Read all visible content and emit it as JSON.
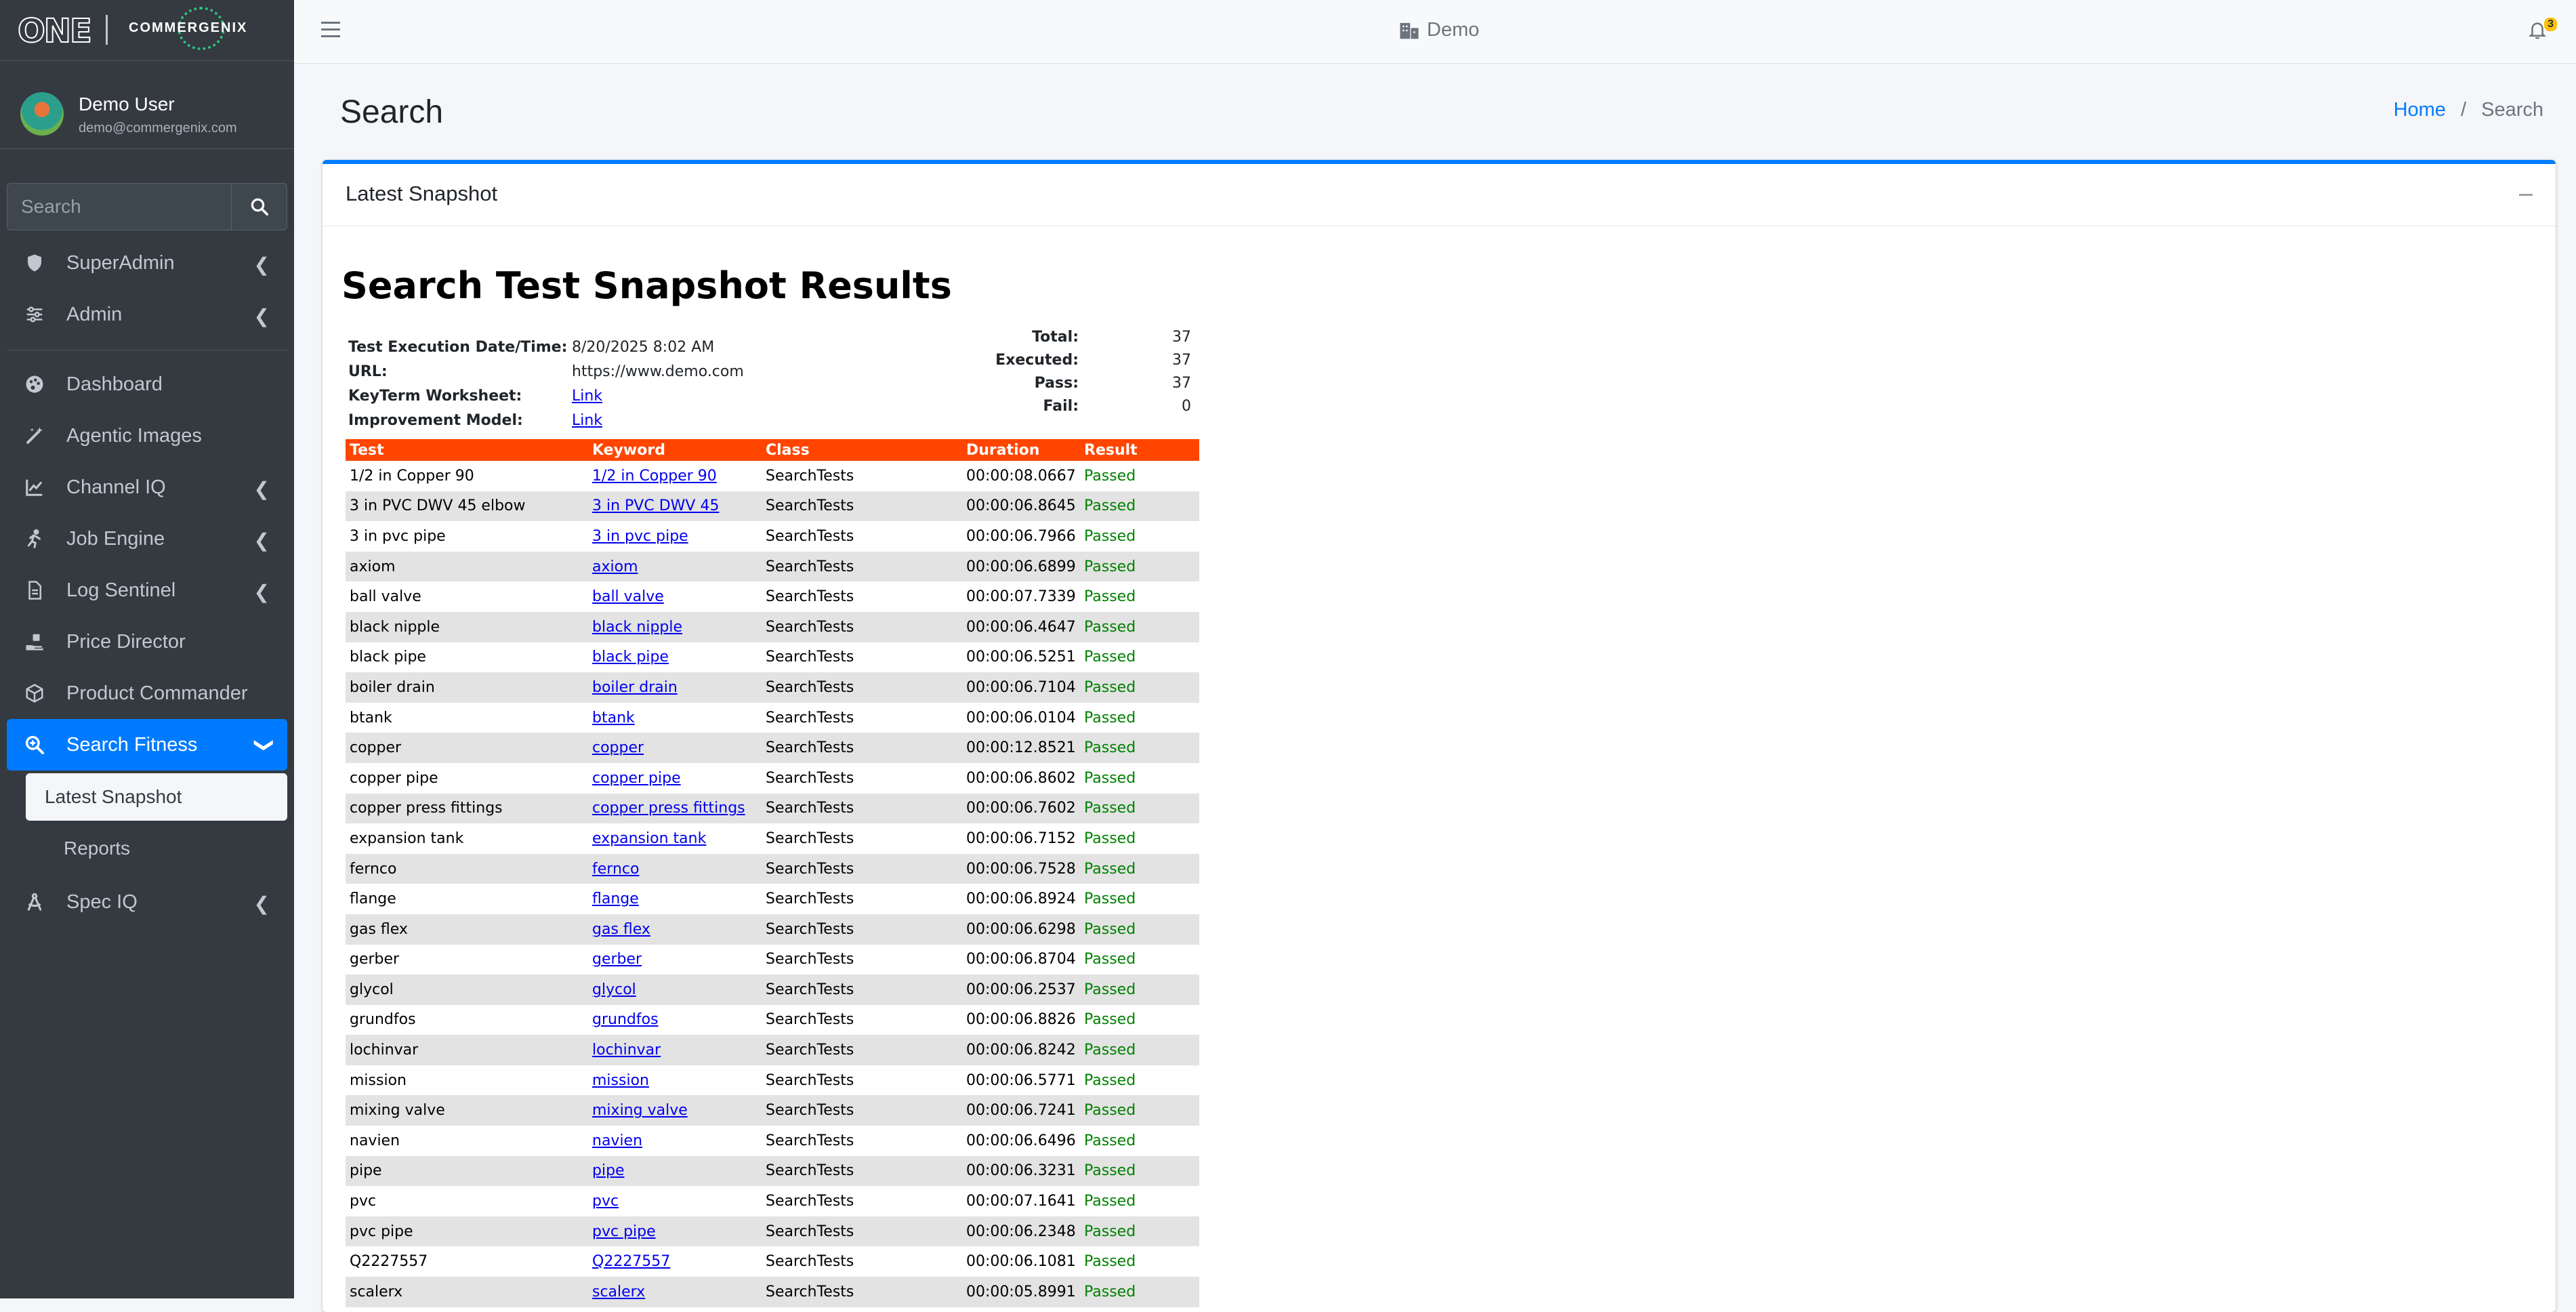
{
  "brand": {
    "logo_text": "ONE",
    "company": "COMMERGENIX"
  },
  "user": {
    "name": "Demo User",
    "email": "demo@commergenix.com"
  },
  "sidebar": {
    "search_placeholder": "Search",
    "items": [
      {
        "label": "SuperAdmin",
        "icon": "shield-icon",
        "expandable": true
      },
      {
        "label": "Admin",
        "icon": "sliders-icon",
        "expandable": true
      },
      {
        "label": "Dashboard",
        "icon": "palette-icon",
        "expandable": false
      },
      {
        "label": "Agentic Images",
        "icon": "magic-wand-icon",
        "expandable": false
      },
      {
        "label": "Channel IQ",
        "icon": "chart-line-icon",
        "expandable": true
      },
      {
        "label": "Job Engine",
        "icon": "running-icon",
        "expandable": true
      },
      {
        "label": "Log Sentinel",
        "icon": "file-icon",
        "expandable": true
      },
      {
        "label": "Price Director",
        "icon": "hand-money-icon",
        "expandable": false
      },
      {
        "label": "Product Commander",
        "icon": "box-icon",
        "expandable": false
      },
      {
        "label": "Search Fitness",
        "icon": "search-plus-icon",
        "expandable": true,
        "active": true
      },
      {
        "label": "Spec IQ",
        "icon": "drafting-compass-icon",
        "expandable": true
      }
    ],
    "subitems": [
      {
        "label": "Latest Snapshot",
        "active": true
      },
      {
        "label": "Reports",
        "active": false
      }
    ]
  },
  "topbar": {
    "tenant": "Demo",
    "notification_count": "3"
  },
  "page": {
    "title": "Search",
    "breadcrumb": {
      "home": "Home",
      "current": "Search"
    }
  },
  "card": {
    "title": "Latest Snapshot"
  },
  "report": {
    "title": "Search Test Snapshot Results",
    "meta": {
      "date_label": "Test Execution Date/Time:",
      "date_value": "8/20/2025 8:02 AM",
      "url_label": "URL:",
      "url_value": "https://www.demo.com",
      "keyterm_label": "KeyTerm Worksheet:",
      "keyterm_value": "Link",
      "model_label": "Improvement Model:",
      "model_value": "Link"
    },
    "totals": {
      "total_label": "Total:",
      "total": "37",
      "executed_label": "Executed:",
      "executed": "37",
      "pass_label": "Pass:",
      "pass": "37",
      "fail_label": "Fail:",
      "fail": "0"
    },
    "columns": {
      "test": "Test",
      "keyword": "Keyword",
      "class": "Class",
      "duration": "Duration",
      "result": "Result"
    },
    "rows": [
      {
        "test": "1/2 in Copper 90",
        "keyword": "1/2 in Copper 90",
        "class": "SearchTests",
        "duration": "00:00:08.0667",
        "result": "Passed"
      },
      {
        "test": "3 in PVC DWV 45 elbow",
        "keyword": "3 in PVC DWV 45",
        "class": "SearchTests",
        "duration": "00:00:06.8645",
        "result": "Passed"
      },
      {
        "test": "3 in pvc pipe",
        "keyword": "3 in pvc pipe",
        "class": "SearchTests",
        "duration": "00:00:06.7966",
        "result": "Passed"
      },
      {
        "test": "axiom",
        "keyword": "axiom",
        "class": "SearchTests",
        "duration": "00:00:06.6899",
        "result": "Passed"
      },
      {
        "test": "ball valve",
        "keyword": "ball valve",
        "class": "SearchTests",
        "duration": "00:00:07.7339",
        "result": "Passed"
      },
      {
        "test": "black nipple",
        "keyword": "black nipple",
        "class": "SearchTests",
        "duration": "00:00:06.4647",
        "result": "Passed"
      },
      {
        "test": "black pipe",
        "keyword": "black pipe",
        "class": "SearchTests",
        "duration": "00:00:06.5251",
        "result": "Passed"
      },
      {
        "test": "boiler drain",
        "keyword": "boiler drain",
        "class": "SearchTests",
        "duration": "00:00:06.7104",
        "result": "Passed"
      },
      {
        "test": "btank",
        "keyword": "btank",
        "class": "SearchTests",
        "duration": "00:00:06.0104",
        "result": "Passed"
      },
      {
        "test": "copper",
        "keyword": "copper",
        "class": "SearchTests",
        "duration": "00:00:12.8521",
        "result": "Passed"
      },
      {
        "test": "copper pipe",
        "keyword": "copper pipe",
        "class": "SearchTests",
        "duration": "00:00:06.8602",
        "result": "Passed"
      },
      {
        "test": "copper press fittings",
        "keyword": "copper press fittings",
        "class": "SearchTests",
        "duration": "00:00:06.7602",
        "result": "Passed"
      },
      {
        "test": "expansion tank",
        "keyword": "expansion tank",
        "class": "SearchTests",
        "duration": "00:00:06.7152",
        "result": "Passed"
      },
      {
        "test": "fernco",
        "keyword": "fernco",
        "class": "SearchTests",
        "duration": "00:00:06.7528",
        "result": "Passed"
      },
      {
        "test": "flange",
        "keyword": "flange",
        "class": "SearchTests",
        "duration": "00:00:06.8924",
        "result": "Passed"
      },
      {
        "test": "gas flex",
        "keyword": "gas flex",
        "class": "SearchTests",
        "duration": "00:00:06.6298",
        "result": "Passed"
      },
      {
        "test": "gerber",
        "keyword": "gerber",
        "class": "SearchTests",
        "duration": "00:00:06.8704",
        "result": "Passed"
      },
      {
        "test": "glycol",
        "keyword": "glycol",
        "class": "SearchTests",
        "duration": "00:00:06.2537",
        "result": "Passed"
      },
      {
        "test": "grundfos",
        "keyword": "grundfos",
        "class": "SearchTests",
        "duration": "00:00:06.8826",
        "result": "Passed"
      },
      {
        "test": "lochinvar",
        "keyword": "lochinvar",
        "class": "SearchTests",
        "duration": "00:00:06.8242",
        "result": "Passed"
      },
      {
        "test": "mission",
        "keyword": "mission",
        "class": "SearchTests",
        "duration": "00:00:06.5771",
        "result": "Passed"
      },
      {
        "test": "mixing valve",
        "keyword": "mixing valve",
        "class": "SearchTests",
        "duration": "00:00:06.7241",
        "result": "Passed"
      },
      {
        "test": "navien",
        "keyword": "navien",
        "class": "SearchTests",
        "duration": "00:00:06.6496",
        "result": "Passed"
      },
      {
        "test": "pipe",
        "keyword": "pipe",
        "class": "SearchTests",
        "duration": "00:00:06.3231",
        "result": "Passed"
      },
      {
        "test": "pvc",
        "keyword": "pvc",
        "class": "SearchTests",
        "duration": "00:00:07.1641",
        "result": "Passed"
      },
      {
        "test": "pvc pipe",
        "keyword": "pvc pipe",
        "class": "SearchTests",
        "duration": "00:00:06.2348",
        "result": "Passed"
      },
      {
        "test": "Q2227557",
        "keyword": "Q2227557",
        "class": "SearchTests",
        "duration": "00:00:06.1081",
        "result": "Passed"
      },
      {
        "test": "scalerx",
        "keyword": "scalerx",
        "class": "SearchTests",
        "duration": "00:00:05.8991",
        "result": "Passed"
      }
    ]
  },
  "colors": {
    "accent": "#007bff",
    "sidebar": "#343a40",
    "table_header": "#ff4500",
    "passed": "#008000"
  }
}
